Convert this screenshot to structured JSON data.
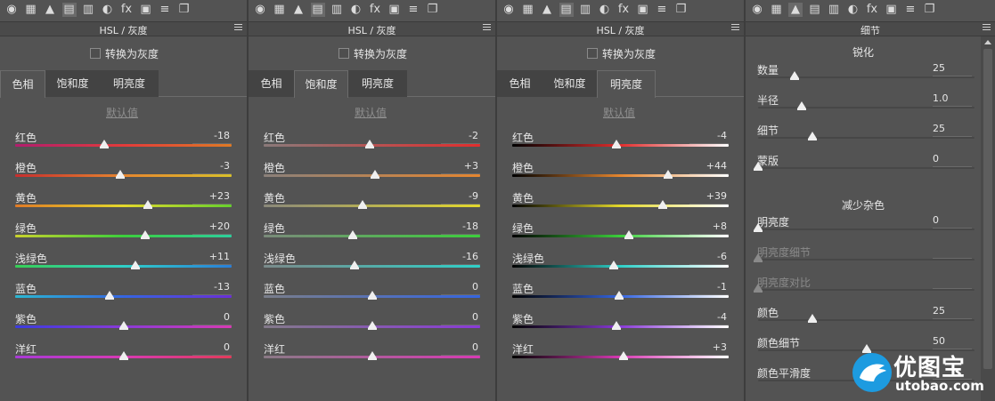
{
  "panels": [
    {
      "title": "HSL / 灰度",
      "convert_gray": "转换为灰度",
      "tabs": [
        "色相",
        "饱和度",
        "明亮度"
      ],
      "active_tab": 0,
      "default_link": "默认值",
      "sliders": [
        {
          "label": "红色",
          "value": "-18"
        },
        {
          "label": "橙色",
          "value": "-3"
        },
        {
          "label": "黄色",
          "value": "+23"
        },
        {
          "label": "绿色",
          "value": "+20"
        },
        {
          "label": "浅绿色",
          "value": "+11"
        },
        {
          "label": "蓝色",
          "value": "-13"
        },
        {
          "label": "紫色",
          "value": "0"
        },
        {
          "label": "洋红",
          "value": "0"
        }
      ]
    },
    {
      "title": "HSL / 灰度",
      "convert_gray": "转换为灰度",
      "tabs": [
        "色相",
        "饱和度",
        "明亮度"
      ],
      "active_tab": 1,
      "default_link": "默认值",
      "sliders": [
        {
          "label": "红色",
          "value": "-2"
        },
        {
          "label": "橙色",
          "value": "+3"
        },
        {
          "label": "黄色",
          "value": "-9"
        },
        {
          "label": "绿色",
          "value": "-18"
        },
        {
          "label": "浅绿色",
          "value": "-16"
        },
        {
          "label": "蓝色",
          "value": "0"
        },
        {
          "label": "紫色",
          "value": "0"
        },
        {
          "label": "洋红",
          "value": "0"
        }
      ]
    },
    {
      "title": "HSL / 灰度",
      "convert_gray": "转换为灰度",
      "tabs": [
        "色相",
        "饱和度",
        "明亮度"
      ],
      "active_tab": 2,
      "default_link": "默认值",
      "sliders": [
        {
          "label": "红色",
          "value": "-4"
        },
        {
          "label": "橙色",
          "value": "+44"
        },
        {
          "label": "黄色",
          "value": "+39"
        },
        {
          "label": "绿色",
          "value": "+8"
        },
        {
          "label": "浅绿色",
          "value": "-6"
        },
        {
          "label": "蓝色",
          "value": "-1"
        },
        {
          "label": "紫色",
          "value": "-4"
        },
        {
          "label": "洋红",
          "value": "+3"
        }
      ]
    }
  ],
  "detail": {
    "title": "细节",
    "sharpen_title": "锐化",
    "sharpen": [
      {
        "label": "数量",
        "value": "25",
        "level": 0.17
      },
      {
        "label": "半径",
        "value": "1.0",
        "level": 0.2
      },
      {
        "label": "细节",
        "value": "25",
        "level": 0.25
      },
      {
        "label": "蒙版",
        "value": "0",
        "level": 0.0
      }
    ],
    "noise_title": "减少杂色",
    "noise": [
      {
        "label": "明亮度",
        "value": "0",
        "level": 0.0,
        "disabled": false
      },
      {
        "label": "明亮度细节",
        "value": "",
        "level": 0.0,
        "disabled": true
      },
      {
        "label": "明亮度对比",
        "value": "",
        "level": 0.0,
        "disabled": true
      },
      {
        "label": "颜色",
        "value": "25",
        "level": 0.25,
        "disabled": false
      },
      {
        "label": "颜色细节",
        "value": "50",
        "level": 0.5,
        "disabled": false
      },
      {
        "label": "颜色平滑度",
        "value": "",
        "level": 0.5,
        "disabled": false
      }
    ]
  },
  "toolbar_icons": [
    "basic-aperture-icon",
    "tone-curve-icon",
    "detail-triangle-icon",
    "hsl-icon",
    "split-toning-icon",
    "lens-corrections-icon",
    "effects-fx-icon",
    "camera-calibration-icon",
    "presets-sliders-icon",
    "snapshots-icon"
  ],
  "toolbar_glyphs": [
    "◉",
    "▦",
    "▲",
    "▤",
    "▥",
    "◐",
    "fx",
    "▣",
    "≡",
    "❐"
  ],
  "watermark": {
    "brand": "优图宝",
    "url": "utobao.com"
  },
  "colors": {
    "red": "#e23b3b",
    "orange": "#e6862f",
    "yellow": "#e3d82c",
    "green": "#3ccf3c",
    "aqua": "#2fd0c8",
    "blue": "#3565e0",
    "purple": "#8a3ad8",
    "magenta": "#d83ab4"
  }
}
